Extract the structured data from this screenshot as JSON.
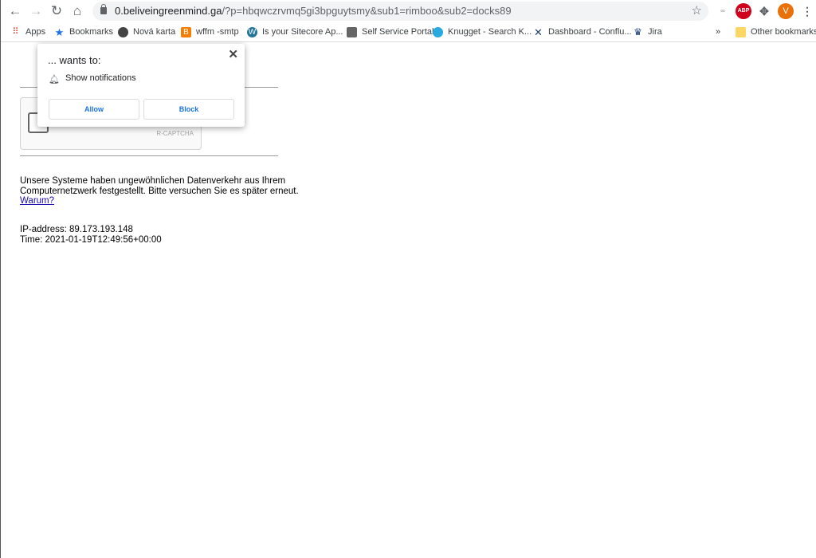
{
  "browser": {
    "url_host": "0.beliveingreenmind.ga",
    "url_path": "/?p=hbqwczrvmq5gi3bpguytsmy&sub1=rimboo&sub2=docks89",
    "profile_initial": "V",
    "abp_label": "ABP",
    "bookmarks": [
      {
        "label": "Apps",
        "icon": "apps-grid-icon"
      },
      {
        "label": "Bookmarks",
        "icon": "star-icon"
      },
      {
        "label": "Nová karta",
        "icon": "globe-icon"
      },
      {
        "label": "wffm -smtp",
        "icon": "blogger-icon"
      },
      {
        "label": "Is your Sitecore Ap...",
        "icon": "wordpress-icon"
      },
      {
        "label": "Self Service Portal",
        "icon": "portal-icon"
      },
      {
        "label": "Knugget - Search K...",
        "icon": "knugget-icon"
      },
      {
        "label": "Dashboard - Conflu...",
        "icon": "confluence-icon"
      },
      {
        "label": "Jira",
        "icon": "jira-icon"
      }
    ],
    "overflow_label": "»",
    "other_bookmarks": "Other bookmarks"
  },
  "popup": {
    "title": "... wants to:",
    "permission": "Show notifications",
    "allow": "Allow",
    "block": "Block"
  },
  "page": {
    "captcha_label": "R-CAPTCHA",
    "message_line1": "Unsere Systeme haben ungewöhnlichen Datenverkehr aus Ihrem",
    "message_line2": "Computernetzwerk festgestellt. Bitte versuchen Sie es später erneut.",
    "why_link": "Warum?",
    "ip_line": "IP-address: 89.173.193.148",
    "time_line": "Time: 2021-01-19T12:49:56+00:00"
  },
  "colors": {
    "accent": "#1a73e8",
    "profile": "#e8710a",
    "abp": "#d0021b"
  }
}
